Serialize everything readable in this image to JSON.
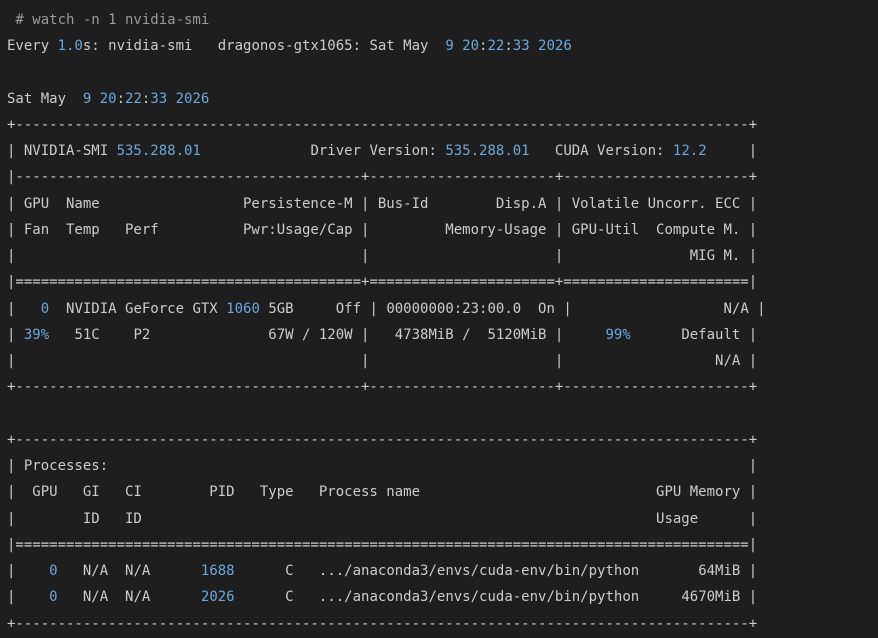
{
  "colors": {
    "background": "#1e1e1e",
    "text": "#cccccc",
    "number": "#6aa9dc"
  },
  "terminal": {
    "lines": [
      [
        {
          "t": " # watch -n 1 nvidia-smi",
          "c": "dim"
        }
      ],
      [
        {
          "t": "Every "
        },
        {
          "t": "1.0",
          "c": "num"
        },
        {
          "t": "s: nvidia-smi   dragonos-gtx1065: Sat May  "
        },
        {
          "t": "9 20",
          "c": "num"
        },
        {
          "t": ":"
        },
        {
          "t": "22",
          "c": "num"
        },
        {
          "t": ":"
        },
        {
          "t": "33 2026",
          "c": "num"
        }
      ],
      [
        {
          "t": ""
        }
      ],
      [
        {
          "t": "Sat May  "
        },
        {
          "t": "9 20",
          "c": "num"
        },
        {
          "t": ":"
        },
        {
          "t": "22",
          "c": "num"
        },
        {
          "t": ":"
        },
        {
          "t": "33 2026",
          "c": "num"
        }
      ],
      [
        {
          "t": "+---------------------------------------------------------------------------------------+"
        }
      ],
      [
        {
          "t": "| NVIDIA-SMI "
        },
        {
          "t": "535.288.01",
          "c": "num"
        },
        {
          "t": "             Driver Version: "
        },
        {
          "t": "535.288.01",
          "c": "num"
        },
        {
          "t": "   CUDA Version: "
        },
        {
          "t": "12.2",
          "c": "num"
        },
        {
          "t": "     |"
        }
      ],
      [
        {
          "t": "|-----------------------------------------+----------------------+----------------------+"
        }
      ],
      [
        {
          "t": "| GPU  Name                 Persistence-M | Bus-Id        Disp.A | Volatile Uncorr. ECC |"
        }
      ],
      [
        {
          "t": "| Fan  Temp   Perf          Pwr:Usage/Cap |         Memory-Usage | GPU-Util  Compute M. |"
        }
      ],
      [
        {
          "t": "|                                         |                      |               MIG M. |"
        }
      ],
      [
        {
          "t": "|=========================================+======================+======================|"
        }
      ],
      [
        {
          "t": "|   "
        },
        {
          "t": "0",
          "c": "num"
        },
        {
          "t": "  NVIDIA GeForce GTX "
        },
        {
          "t": "1060",
          "c": "num"
        },
        {
          "t": " 5GB     Off | 00000000:23:00.0  On |                  N/A |"
        }
      ],
      [
        {
          "t": "| "
        },
        {
          "t": "39%",
          "c": "num"
        },
        {
          "t": "   51C    P2              67W / 120W |   4738MiB /  5120MiB |     "
        },
        {
          "t": "99%",
          "c": "num"
        },
        {
          "t": "      Default |"
        }
      ],
      [
        {
          "t": "|                                         |                      |                  N/A |"
        }
      ],
      [
        {
          "t": "+-----------------------------------------+----------------------+----------------------+"
        }
      ],
      [
        {
          "t": ""
        }
      ],
      [
        {
          "t": "+---------------------------------------------------------------------------------------+"
        }
      ],
      [
        {
          "t": "| Processes:                                                                            |"
        }
      ],
      [
        {
          "t": "|  GPU   GI   CI        PID   Type   Process name                            GPU Memory |"
        }
      ],
      [
        {
          "t": "|        ID   ID                                                             Usage      |"
        }
      ],
      [
        {
          "t": "|=======================================================================================|"
        }
      ],
      [
        {
          "t": "|    "
        },
        {
          "t": "0",
          "c": "num"
        },
        {
          "t": "   N/A  N/A      "
        },
        {
          "t": "1688",
          "c": "num"
        },
        {
          "t": "      C   .../anaconda3/envs/cuda-env/bin/python       64MiB |"
        }
      ],
      [
        {
          "t": "|    "
        },
        {
          "t": "0",
          "c": "num"
        },
        {
          "t": "   N/A  N/A      "
        },
        {
          "t": "2026",
          "c": "num"
        },
        {
          "t": "      C   .../anaconda3/envs/cuda-env/bin/python     4670MiB |"
        }
      ],
      [
        {
          "t": "+---------------------------------------------------------------------------------------+"
        }
      ]
    ]
  }
}
